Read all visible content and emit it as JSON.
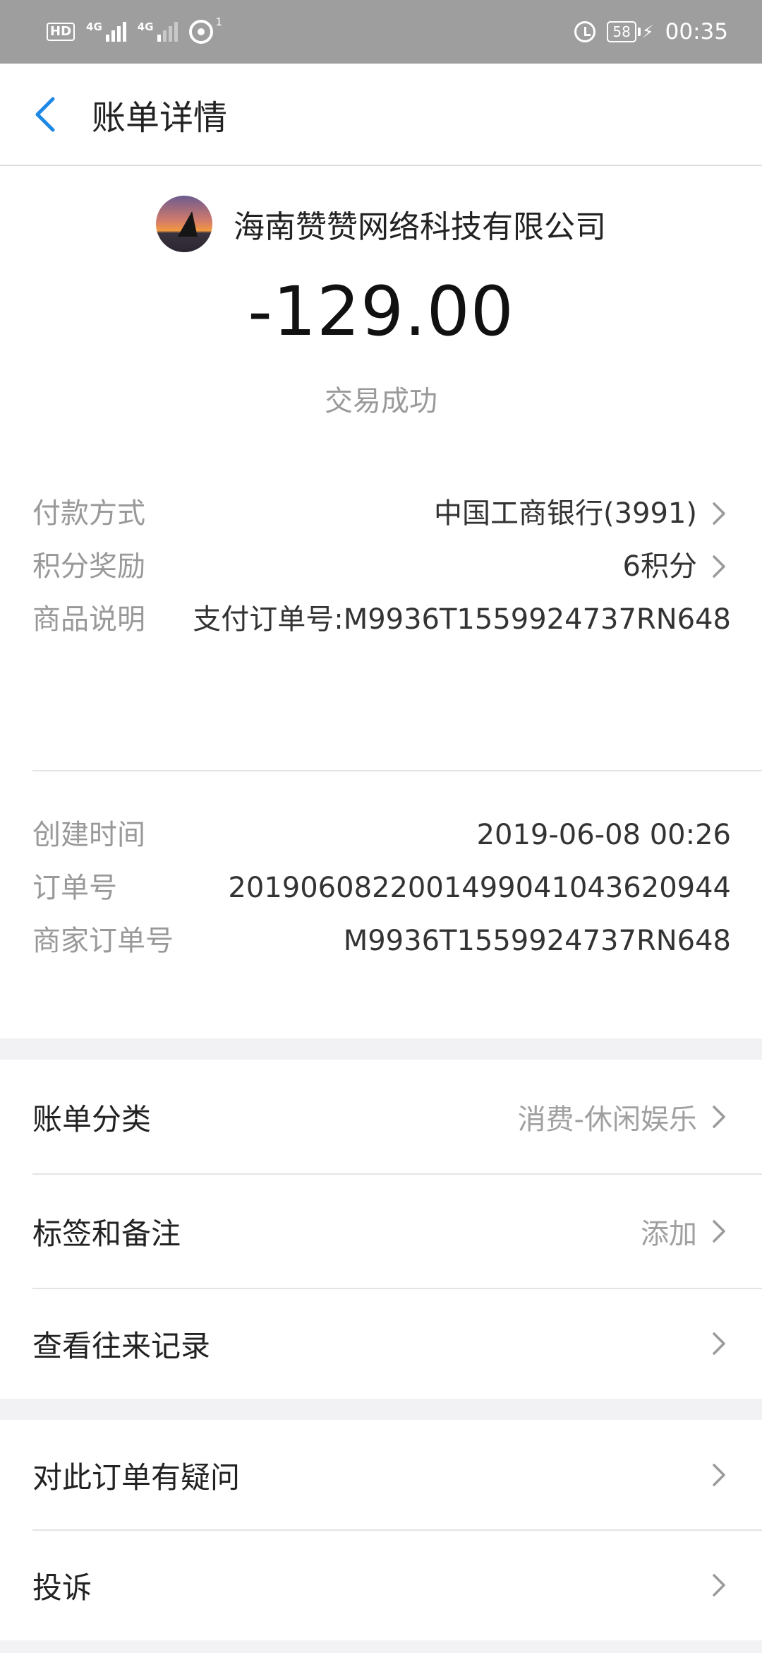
{
  "status_bar": {
    "hd": "HD",
    "signal1_label": "4G",
    "signal2_label": "4G",
    "hotspot_count": "1",
    "battery": "58",
    "time": "00:35"
  },
  "header": {
    "title": "账单详情"
  },
  "summary": {
    "merchant": "海南赞赞网络科技有限公司",
    "amount": "-129.00",
    "status": "交易成功"
  },
  "details": [
    {
      "label": "付款方式",
      "value": "中国工商银行(3991)",
      "link": true
    },
    {
      "label": "积分奖励",
      "value": "6积分",
      "link": true
    },
    {
      "label": "商品说明",
      "value": "支付订单号:M9936T1559924737RN648",
      "link": false
    }
  ],
  "details2": [
    {
      "label": "创建时间",
      "value": "2019-06-08 00:26"
    },
    {
      "label": "订单号",
      "value": "2019060822001499041043620944"
    },
    {
      "label": "商家订单号",
      "value": "M9936T1559924737RN648"
    }
  ],
  "group1": [
    {
      "label": "账单分类",
      "value": "消费-休闲娱乐"
    },
    {
      "label": "标签和备注",
      "value": "添加"
    },
    {
      "label": "查看往来记录",
      "value": ""
    }
  ],
  "group2": [
    {
      "label": "对此订单有疑问",
      "value": ""
    },
    {
      "label": "投诉",
      "value": ""
    }
  ],
  "colors": {
    "accent": "#1e88e5",
    "status_bar": "#9e9e9e",
    "label_gray": "#999999",
    "background": "#f2f2f4"
  },
  "icons": {
    "back": "chevron-left-icon",
    "row": "chevron-right-icon"
  }
}
